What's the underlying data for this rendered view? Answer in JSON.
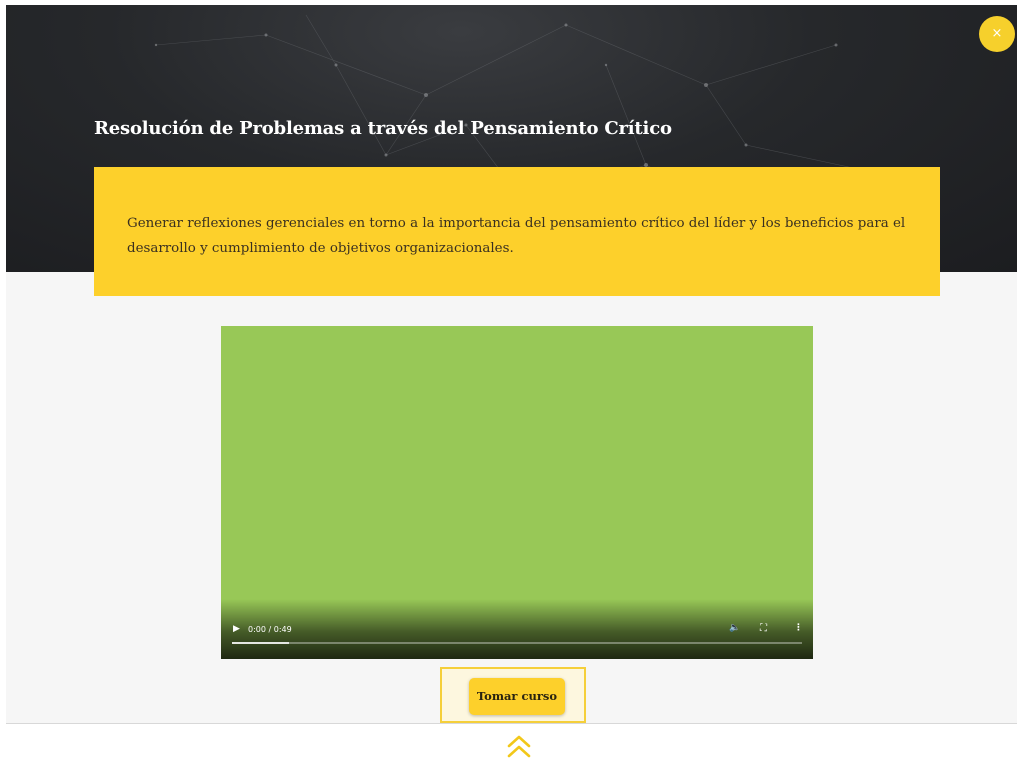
{
  "modal": {
    "close_label": "×",
    "course_title": "Resolución de Problemas a través del Pensamiento Crítico",
    "objective": "Generar reflexiones gerenciales en torno a la importancia del pensamiento crítico del líder y los beneficios para el desarrollo y cumplimiento de objetivos organizacionales."
  },
  "video": {
    "time": "0:00 / 0:49",
    "play_icon": "▶",
    "volume_icon": "🔈",
    "fullscreen_icon": "⛶",
    "more_icon": "⋮",
    "buffered_fraction": 0.1,
    "background_color": "#98c857"
  },
  "cta": {
    "label": "Tomar curso"
  },
  "icons": {
    "close": "close-icon",
    "scroll_up": "double-chevron-up-icon"
  },
  "colors": {
    "accent": "#fdd02b",
    "hero_bg": "#26282b"
  }
}
